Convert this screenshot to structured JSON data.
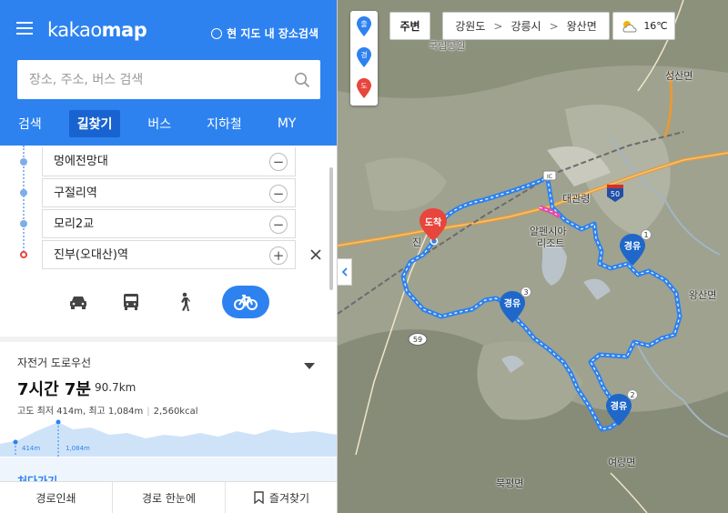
{
  "header": {
    "logo_light": "kakao",
    "logo_bold": "map",
    "scope_label": "현 지도 내 장소검색"
  },
  "search": {
    "placeholder": "장소, 주소, 버스 검색"
  },
  "tabs": [
    {
      "label": "검색"
    },
    {
      "label": "길찾기",
      "active": true
    },
    {
      "label": "버스"
    },
    {
      "label": "지하철"
    },
    {
      "label": "MY"
    }
  ],
  "waypoints": [
    {
      "name": "멍에전망대",
      "action": "−"
    },
    {
      "name": "구절리역",
      "action": "−"
    },
    {
      "name": "모리2교",
      "action": "−"
    },
    {
      "name": "진부(오대산)역",
      "action": "+"
    }
  ],
  "modes": [
    {
      "icon": "car-icon"
    },
    {
      "icon": "bus-icon"
    },
    {
      "icon": "walk-icon"
    },
    {
      "icon": "bicycle-icon",
      "active": true
    }
  ],
  "route": {
    "type": "자전거 도로우선",
    "time": "7시간 7분",
    "distance": "90.7km",
    "elevation": "고도 최저 414m, 최고 1,084m",
    "calories": "2,560kcal",
    "elev_low": "414m",
    "elev_high": "1,084m",
    "next_section": "처다가기"
  },
  "footer": {
    "print": "경로인쇄",
    "overview": "경로 한눈에",
    "favorite": "즐겨찾기"
  },
  "map": {
    "pins": {
      "start": "출",
      "via": "경",
      "dest": "도"
    },
    "nearby": "주변",
    "breadcrumb": [
      "강원도",
      "강릉시",
      "왕산면"
    ],
    "weather_temp": "16℃",
    "labels": {
      "seongsan": "성산면",
      "daegwallyeong": "대관령",
      "alpensia_1": "알펜시아",
      "alpensia_2": "리조트",
      "wangsan": "왕산면",
      "bukpyeong": "북평면",
      "yeoryang": "여량면",
      "jin": "진",
      "ic": "IC",
      "road_50": "50",
      "road_59": "59",
      "top_label": "국립공원"
    },
    "markers": {
      "arrival": "도착",
      "via": "경유",
      "via1_num": "1",
      "via2_num": "2",
      "via3_num": "3"
    },
    "colors": {
      "route": "#2d82f0",
      "accent": "#2d82f0",
      "arrival": "#e8453c",
      "detour": "#e44ca8"
    }
  }
}
